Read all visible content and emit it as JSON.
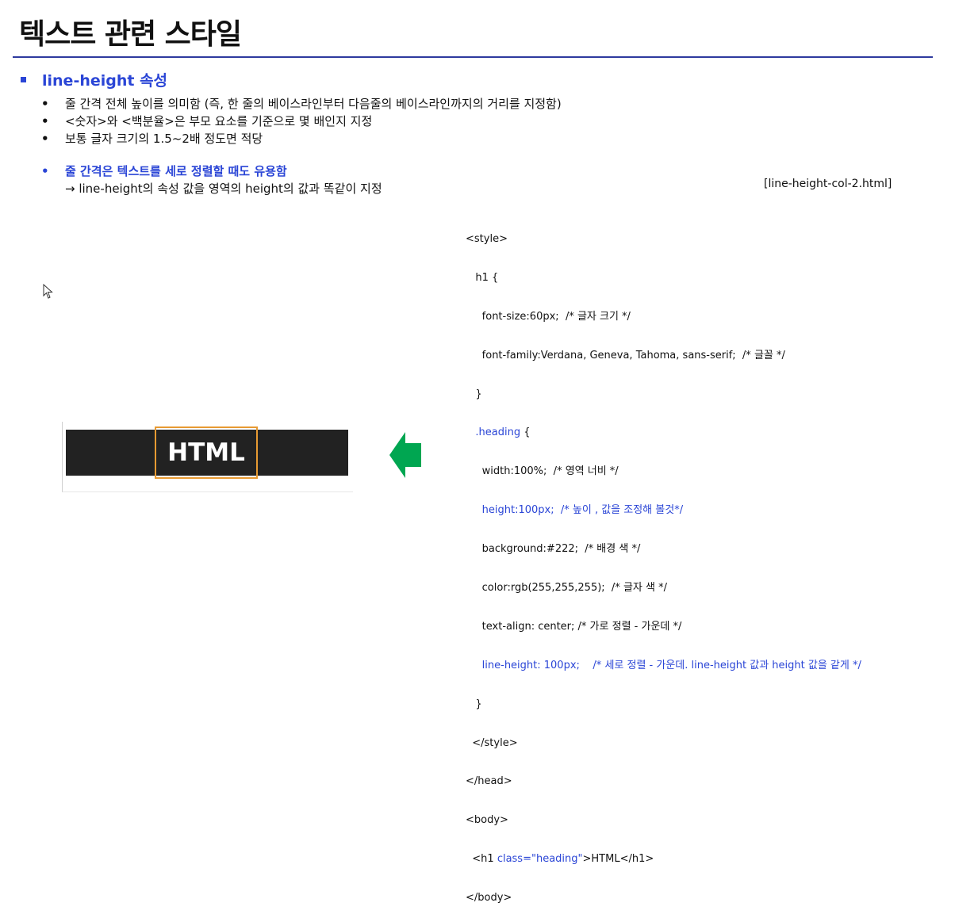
{
  "title": "텍스트 관련 스타일",
  "section": {
    "heading": "line-height 속성"
  },
  "bullets": [
    "줄 간격 전체 높이를 의미함 (즉, 한 줄의 베이스라인부터 다음줄의 베이스라인까지의 거리를 지정함)",
    "<숫자>와 <백분율>은 부모 요소를 기준으로 몇 배인지 지정",
    "보통 글자 크기의 1.5~2배 정도면 적당"
  ],
  "note": {
    "line1": "줄 간격은 텍스트를 세로 정렬할 때도 유용함",
    "line2": "→ line-height의 속성 값을 영역의 height의 값과 똑같이 지정"
  },
  "filename": "[line-height-col-2.html]",
  "code": {
    "l01": "<style>",
    "l02": "   h1 {",
    "l03": "     font-size:60px;  /* 글자 크기 */",
    "l04": "     font-family:Verdana, Geneva, Tahoma, sans-serif;  /* 글꼴 */",
    "l05": "   }",
    "l06": "   .heading",
    "l06b": " {",
    "l07": "     width:100%;  /* 영역 너비 */",
    "l08": "     height:100px;  /* 높이 , 값을 조정해 볼것*/",
    "l09": "     background:#222;  /* 배경 색 */",
    "l10": "     color:rgb(255,255,255);  /* 글자 색 */",
    "l11": "     text-align: center; /* 가로 정렬 - 가운데 */",
    "l12": "     line-height: 100px;    /* 세로 정렬 - 가운데. line-height 값과 height 값을 같게 */",
    "l13": "   }",
    "l14": "  </style>",
    "l15": "</head>",
    "l16": "<body>",
    "l17a": "  <h1 ",
    "l17b": "class=\"heading\"",
    "l17c": ">HTML</h1>",
    "l18": "</body>"
  },
  "demo": {
    "text": "HTML"
  },
  "colors": {
    "accent": "#2a45d6",
    "rule": "#2e3a9e",
    "demo_bg": "#222222",
    "highlight": "#e79a32",
    "arrow": "#00a651"
  }
}
